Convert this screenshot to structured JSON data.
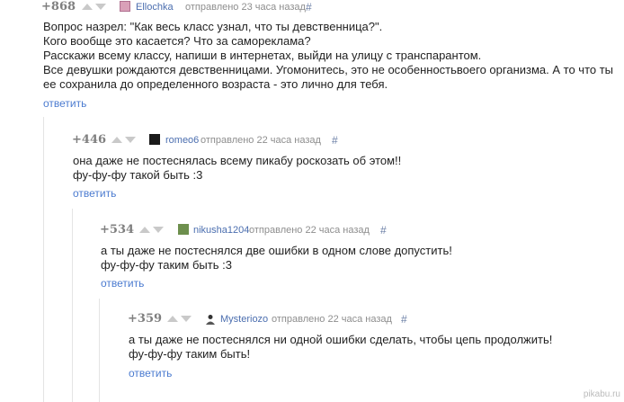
{
  "comments": [
    {
      "rating": "+868",
      "author": "Ellochka",
      "time": "отправлено 23 часа назад",
      "hash": "#",
      "lines": [
        "Вопрос назрел: \"Как весь класс узнал, что ты девственница?\".",
        "Кого вообще это касается? Что за самореклама?",
        "Расскажи всему классу, напиши в интернетах, выйди на улицу с транспарантом.",
        "Все девушки рождаются девственницами. Угомонитесь, это не особенностьвоего организма. А то что ты",
        "ее сохранила до определенного возраста - это лично для тебя."
      ],
      "reply": "ответить"
    },
    {
      "rating": "+446",
      "author": "romeo6",
      "time": "отправлено 22 часа назад",
      "hash": "#",
      "lines": [
        "она даже не постеснялась всему пикабу роскозать об этом!!",
        "фу-фу-фу такой быть :3"
      ],
      "reply": "ответить"
    },
    {
      "rating": "+534",
      "author": "nikusha1204",
      "time": "отправлено 22 часа назад",
      "hash": "#",
      "lines": [
        "а ты даже не постеснялся две ошибки в одном слове допустить!",
        "фу-фу-фу таким быть :3"
      ],
      "reply": "ответить"
    },
    {
      "rating": "+359",
      "author": "Mysteriozo",
      "time": "отправлено 22 часа назад",
      "hash": "#",
      "lines": [
        "а ты даже не постеснялся ни одной ошибки сделать, чтобы цепь продолжить!",
        "фу-фу-фу таким быть!"
      ],
      "reply": "ответить"
    }
  ],
  "watermark": "pikabu.ru",
  "colors": {
    "author": "#4b6eaf",
    "reply": "#4b7bd0",
    "rating": "#7f7f7f",
    "meta": "#8e8e8e",
    "arrow": "#c9c9c9"
  },
  "icons": [
    "arrow-up-icon",
    "arrow-down-icon",
    "avatar"
  ]
}
